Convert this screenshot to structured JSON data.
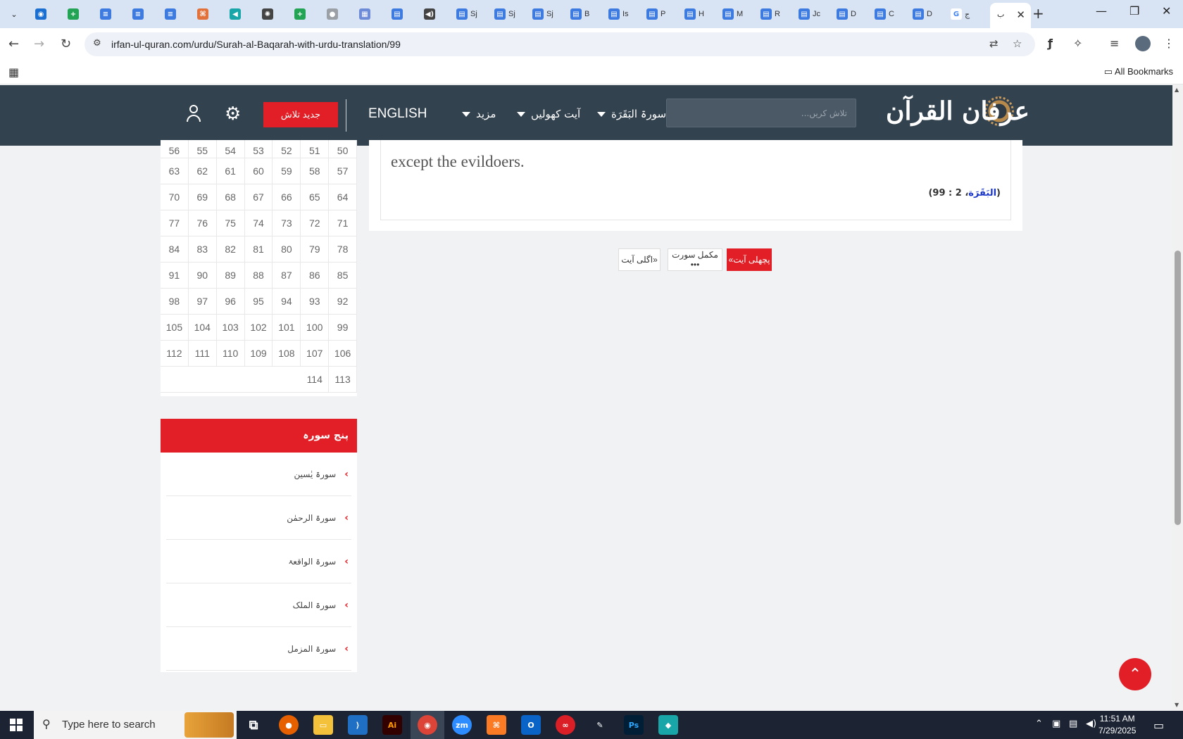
{
  "browser": {
    "tabs": [
      {
        "label": "",
        "color": "#1b6fd1",
        "glyph": "◉"
      },
      {
        "label": "",
        "color": "#23a455",
        "glyph": "+"
      },
      {
        "label": "",
        "color": "#3d7be0",
        "glyph": "≡"
      },
      {
        "label": "",
        "color": "#3d7be0",
        "glyph": "≡"
      },
      {
        "label": "",
        "color": "#3d7be0",
        "glyph": "≡"
      },
      {
        "label": "",
        "color": "#e2713a",
        "glyph": "⌘"
      },
      {
        "label": "",
        "color": "#19a6a8",
        "glyph": "◀"
      },
      {
        "label": "",
        "color": "#444444",
        "glyph": "✺"
      },
      {
        "label": "",
        "color": "#23a455",
        "glyph": "+"
      },
      {
        "label": "",
        "color": "#9aa0a6",
        "glyph": "●"
      },
      {
        "label": "",
        "color": "#6d8bd6",
        "glyph": "▦"
      },
      {
        "label": "",
        "color": "#3d7be0",
        "glyph": "▤"
      },
      {
        "label": "",
        "color": "#444444",
        "glyph": "◀)"
      },
      {
        "label": "Sj",
        "color": "#3d7be0",
        "glyph": "▤"
      },
      {
        "label": "Sj",
        "color": "#3d7be0",
        "glyph": "▤"
      },
      {
        "label": "Sj",
        "color": "#3d7be0",
        "glyph": "▤"
      },
      {
        "label": "B",
        "color": "#3d7be0",
        "glyph": "▤"
      },
      {
        "label": "Is",
        "color": "#3d7be0",
        "glyph": "▤"
      },
      {
        "label": "P",
        "color": "#3d7be0",
        "glyph": "▤"
      },
      {
        "label": "H",
        "color": "#3d7be0",
        "glyph": "▤"
      },
      {
        "label": "M",
        "color": "#3d7be0",
        "glyph": "▤"
      },
      {
        "label": "R",
        "color": "#3d7be0",
        "glyph": "▤"
      },
      {
        "label": "Jc",
        "color": "#3d7be0",
        "glyph": "▤"
      },
      {
        "label": "D",
        "color": "#3d7be0",
        "glyph": "▤"
      },
      {
        "label": "C",
        "color": "#3d7be0",
        "glyph": "▤"
      },
      {
        "label": "D",
        "color": "#3d7be0",
        "glyph": "▤"
      },
      {
        "label": "ج",
        "color": "#ffffff",
        "glyph": "G"
      }
    ],
    "active_tab_label": "ب",
    "url": "irfan-ul-quran.com/urdu/Surah-al-Baqarah-with-urdu-translation/99",
    "all_bookmarks": "All Bookmarks"
  },
  "header": {
    "logo_text": "عرفان القرآن",
    "search_placeholder": "تلاش کریں...",
    "nav_surah": "سورۃ البَقَرَة",
    "nav_ayat": "آیت کھولیں",
    "nav_more": "مزید",
    "language": "ENGLISH",
    "advanced_search": "جدید تلاش"
  },
  "ayah_numbers": {
    "rows": [
      [
        "50",
        "51",
        "52",
        "53",
        "54",
        "55",
        "56"
      ],
      [
        "57",
        "58",
        "59",
        "60",
        "61",
        "62",
        "63"
      ],
      [
        "64",
        "65",
        "66",
        "67",
        "68",
        "69",
        "70"
      ],
      [
        "71",
        "72",
        "73",
        "74",
        "75",
        "76",
        "77"
      ],
      [
        "78",
        "79",
        "80",
        "81",
        "82",
        "83",
        "84"
      ],
      [
        "85",
        "86",
        "87",
        "88",
        "89",
        "90",
        "91"
      ],
      [
        "92",
        "93",
        "94",
        "95",
        "96",
        "97",
        "98"
      ],
      [
        "99",
        "100",
        "101",
        "102",
        "103",
        "104",
        "105"
      ],
      [
        "106",
        "107",
        "108",
        "109",
        "110",
        "111",
        "112"
      ],
      [
        "113",
        "114",
        "",
        "",
        "",
        "",
        ""
      ]
    ]
  },
  "verse": {
    "text_tail": "except the evildoers.",
    "ref_open": "(",
    "ref_surah": "البَقَرَة",
    "ref_sep": "، 2 : 99",
    "ref_close": ")"
  },
  "pager": {
    "previous": "«پچھلی آیت",
    "full_surah": "مکمل سورت •••",
    "next": "اگلی آیت»"
  },
  "related": {
    "title": "پنج سورہ",
    "items": [
      "سورۃ یٰسین",
      "سورۃ الرحمٰن",
      "سورۃ الواقعۃ",
      "سورۃ الملک",
      "سورۃ المزمل"
    ]
  },
  "taskbar": {
    "search_placeholder": "Type here to search",
    "time": "11:51 AM",
    "date": "7/29/2025"
  },
  "colors": {
    "header_bg": "#33424f",
    "accent_red": "#e21f26",
    "surah_link_blue": "#1a36c8"
  }
}
